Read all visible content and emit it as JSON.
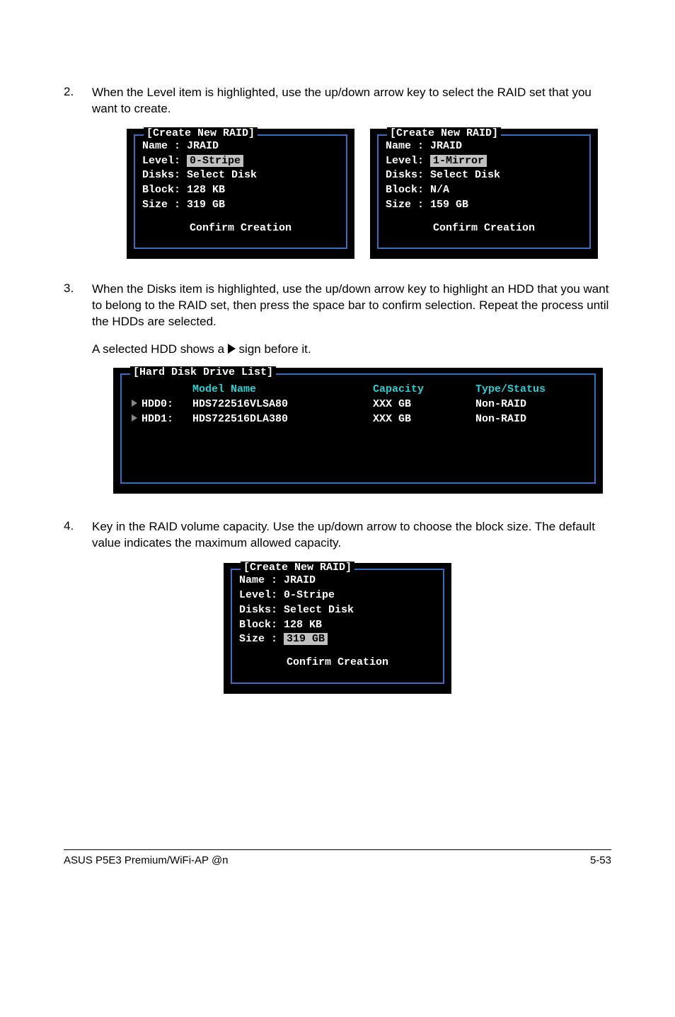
{
  "steps": {
    "s2": {
      "num": "2.",
      "text": "When the Level item is highlighted, use the up/down arrow key to select the RAID set that you want to create."
    },
    "s3": {
      "num": "3.",
      "text": "When the Disks item is highlighted, use the up/down arrow key to highlight an HDD that you want to belong to the RAID set, then press the space bar to confirm selection. Repeat the process until the HDDs are selected.",
      "sub_pre": "A selected HDD shows a ",
      "sub_post": " sign before it."
    },
    "s4": {
      "num": "4.",
      "text": "Key in the RAID volume capacity. Use the up/down arrow to choose the block size. The default value indicates the maximum allowed capacity."
    }
  },
  "panelA": {
    "title": "[Create New RAID]",
    "name": "Name : JRAID",
    "level_lbl": "Level:",
    "level_val": "0-Stripe",
    "disks": "Disks: Select Disk",
    "block": "Block: 128 KB",
    "size": "Size : 319 GB",
    "confirm": "Confirm Creation"
  },
  "panelB": {
    "title": "[Create New RAID]",
    "name": "Name : JRAID",
    "level_lbl": "Level:",
    "level_val": "1-Mirror",
    "disks": "Disks: Select Disk",
    "block": "Block: N/A",
    "size": "Size : 159 GB",
    "confirm": "Confirm Creation"
  },
  "diskList": {
    "title": "[Hard Disk Drive List]",
    "hdr_model": "Model Name",
    "hdr_cap": "Capacity",
    "hdr_type": "Type/Status",
    "rows": [
      {
        "id": "HDD0:",
        "model": "HDS722516VLSA80",
        "cap": "XXX GB",
        "type": "Non-RAID"
      },
      {
        "id": "HDD1:",
        "model": "HDS722516DLA380",
        "cap": "XXX GB",
        "type": "Non-RAID"
      }
    ]
  },
  "panelC": {
    "title": "[Create New RAID]",
    "name": "Name : JRAID",
    "level": "Level: 0-Stripe",
    "disks": "Disks: Select Disk",
    "block": "Block: 128 KB",
    "size_lbl": "Size :",
    "size_val": "319 GB",
    "confirm": "Confirm Creation"
  },
  "footer": {
    "left": "ASUS P5E3 Premium/WiFi-AP @n",
    "right": "5-53"
  }
}
